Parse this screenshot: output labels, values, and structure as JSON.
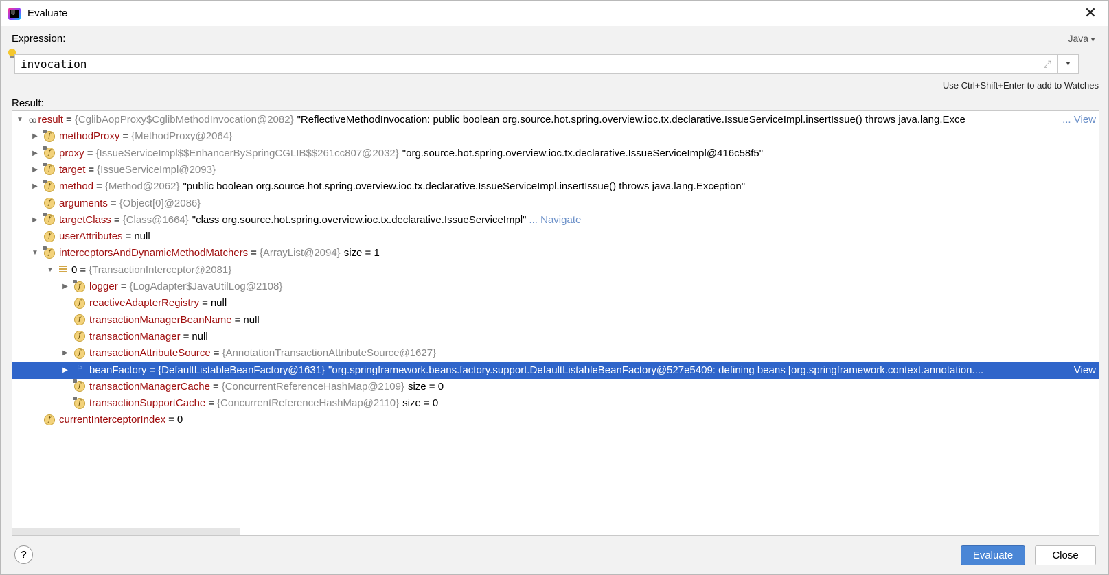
{
  "window": {
    "title": "Evaluate"
  },
  "expression": {
    "label": "Expression:",
    "language": "Java",
    "value": "invocation",
    "hint": "Use Ctrl+Shift+Enter to add to Watches"
  },
  "result": {
    "label": "Result:",
    "rows": [
      {
        "depth": 0,
        "arrow": "▼",
        "icon": "watch",
        "name": "result",
        "ref": "{CglibAopProxy$CglibMethodInvocation@2082}",
        "value": "\"ReflectiveMethodInvocation: public boolean org.source.hot.spring.overview.ioc.tx.declarative.IssueServiceImpl.insertIssue() throws java.lang.Exce",
        "link": "... View",
        "right": true
      },
      {
        "depth": 1,
        "arrow": "▶",
        "icon": "field-lock",
        "name": "methodProxy",
        "ref": "{MethodProxy@2064}",
        "value": "",
        "link": ""
      },
      {
        "depth": 1,
        "arrow": "▶",
        "icon": "field-lock",
        "name": "proxy",
        "ref": "{IssueServiceImpl$$EnhancerBySpringCGLIB$$261cc807@2032}",
        "value": "\"org.source.hot.spring.overview.ioc.tx.declarative.IssueServiceImpl@416c58f5\"",
        "link": ""
      },
      {
        "depth": 1,
        "arrow": "▶",
        "icon": "field-lock",
        "name": "target",
        "ref": "{IssueServiceImpl@2093}",
        "value": "",
        "link": ""
      },
      {
        "depth": 1,
        "arrow": "▶",
        "icon": "field-lock",
        "name": "method",
        "ref": "{Method@2062}",
        "value": "\"public boolean org.source.hot.spring.overview.ioc.tx.declarative.IssueServiceImpl.insertIssue() throws java.lang.Exception\"",
        "link": ""
      },
      {
        "depth": 1,
        "arrow": "",
        "icon": "field",
        "name": "arguments",
        "ref": "{Object[0]@2086}",
        "value": "",
        "link": ""
      },
      {
        "depth": 1,
        "arrow": "▶",
        "icon": "field-lock",
        "name": "targetClass",
        "ref": "{Class@1664}",
        "value": "\"class org.source.hot.spring.overview.ioc.tx.declarative.IssueServiceImpl\"",
        "link": "... Navigate"
      },
      {
        "depth": 1,
        "arrow": "",
        "icon": "field",
        "name": "userAttributes",
        "ref": "null",
        "value": "",
        "link": "",
        "plain": true
      },
      {
        "depth": 1,
        "arrow": "▼",
        "icon": "field-lock",
        "name": "interceptorsAndDynamicMethodMatchers",
        "ref": "{ArrayList@2094}",
        "value": "size = 1",
        "link": ""
      },
      {
        "depth": 2,
        "arrow": "▼",
        "icon": "list",
        "name": "0",
        "ref": "{TransactionInterceptor@2081}",
        "value": "",
        "link": "",
        "plainname": true
      },
      {
        "depth": 3,
        "arrow": "▶",
        "icon": "field-lock",
        "name": "logger",
        "ref": "{LogAdapter$JavaUtilLog@2108}",
        "value": "",
        "link": ""
      },
      {
        "depth": 3,
        "arrow": "",
        "icon": "field",
        "name": "reactiveAdapterRegistry",
        "ref": "null",
        "value": "",
        "link": "",
        "plain": true
      },
      {
        "depth": 3,
        "arrow": "",
        "icon": "field",
        "name": "transactionManagerBeanName",
        "ref": "null",
        "value": "",
        "link": "",
        "plain": true
      },
      {
        "depth": 3,
        "arrow": "",
        "icon": "field",
        "name": "transactionManager",
        "ref": "null",
        "value": "",
        "link": "",
        "plain": true
      },
      {
        "depth": 3,
        "arrow": "▶",
        "icon": "field",
        "name": "transactionAttributeSource",
        "ref": "{AnnotationTransactionAttributeSource@1627}",
        "value": "",
        "link": ""
      },
      {
        "depth": 3,
        "arrow": "▶",
        "icon": "flag",
        "name": "beanFactory",
        "ref": "{DefaultListableBeanFactory@1631}",
        "value": "\"org.springframework.beans.factory.support.DefaultListableBeanFactory@527e5409: defining beans [org.springframework.context.annotation....",
        "link": "View",
        "right": true,
        "selected": true
      },
      {
        "depth": 3,
        "arrow": "",
        "icon": "field-lock",
        "name": "transactionManagerCache",
        "ref": "{ConcurrentReferenceHashMap@2109}",
        "value": "size = 0",
        "link": ""
      },
      {
        "depth": 3,
        "arrow": "",
        "icon": "field-lock",
        "name": "transactionSupportCache",
        "ref": "{ConcurrentReferenceHashMap@2110}",
        "value": "size = 0",
        "link": ""
      },
      {
        "depth": 1,
        "arrow": "",
        "icon": "field",
        "name": "currentInterceptorIndex",
        "ref": "0",
        "value": "",
        "link": "",
        "plain": true
      }
    ]
  },
  "buttons": {
    "help": "?",
    "evaluate": "Evaluate",
    "close": "Close"
  }
}
